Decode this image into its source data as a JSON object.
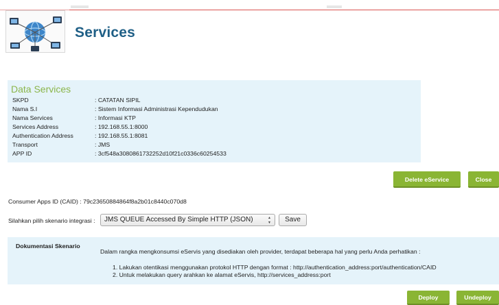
{
  "header": {
    "title": "Services"
  },
  "data_services": {
    "heading": "Data Services",
    "fields": [
      {
        "label": "SKPD",
        "value": ": CATATAN SIPIL"
      },
      {
        "label": "Nama S.I",
        "value": ": Sistem Informasi Administrasi Kependudukan"
      },
      {
        "label": "Nama Services",
        "value": ": Informasi KTP"
      },
      {
        "label": "Services Address",
        "value": ": 192.168.55.1:8000"
      },
      {
        "label": "Authentication Address",
        "value": ": 192.168.55.1:8081"
      },
      {
        "label": "Transport",
        "value": ": JMS"
      },
      {
        "label": "APP ID",
        "value": ": 3cf548a3080861732252d10f21c0336c60254533"
      }
    ]
  },
  "actions": {
    "delete_label": "Delete eService",
    "close_label": "Close"
  },
  "consumer": {
    "caid_text": "Consumer Apps ID (CAID) : 79c23650884864f8a2b01c8440c070d8"
  },
  "scenario": {
    "label": "Silahkan pilih skenario integrasi :",
    "selected": "JMS QUEUE Accessed By Simple HTTP (JSON)",
    "save_label": "Save"
  },
  "documentation": {
    "title": "Dokumentasi Skenario",
    "intro": "Dalam rangka mengkonsumsi eServis yang disediakan oleh provider, terdapat beberapa hal yang perlu Anda perhatikan :",
    "steps": [
      "1.  Lakukan otentikasi menggunakan protokol HTTP dengan format : http://authentication_address:port/authentication/CAID",
      "2.  Untuk melakukan query arahkan ke alamat eServis, http://services_address:port"
    ]
  },
  "footer": {
    "deploy_label": "Deploy",
    "undeploy_label": "Undeploy"
  },
  "colors": {
    "accent_green": "#8ab534",
    "panel_bg": "#e5f3fa",
    "title_blue": "#1f5f86"
  }
}
